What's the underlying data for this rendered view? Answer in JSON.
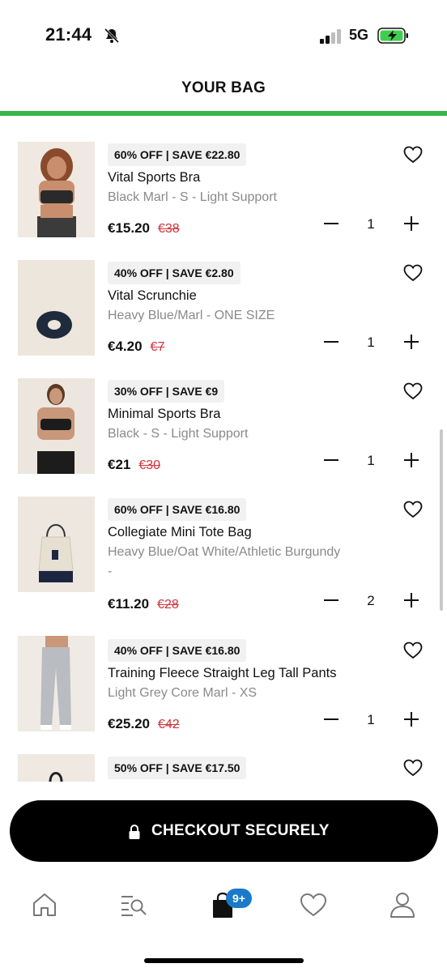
{
  "status_bar": {
    "time": "21:44",
    "network": "5G"
  },
  "header": {
    "title": "YOUR BAG",
    "accent_color": "#3ab54a"
  },
  "items": [
    {
      "badge": "60% OFF | SAVE €22.80",
      "name": "Vital Sports Bra",
      "variant": "Black Marl - S - Light Support",
      "variant_extra": "",
      "price": "€15.20",
      "was_price": "€38",
      "quantity": "1",
      "image": "sports-bra-model-photo"
    },
    {
      "badge": "40% OFF | SAVE €2.80",
      "name": "Vital Scrunchie",
      "variant": "Heavy Blue/Marl - ONE SIZE",
      "variant_extra": "",
      "price": "€4.20",
      "was_price": "€7",
      "quantity": "1",
      "image": "scrunchie-photo"
    },
    {
      "badge": "30% OFF | SAVE €9",
      "name": "Minimal Sports Bra",
      "variant": "Black - S - Light Support",
      "variant_extra": "",
      "price": "€21",
      "was_price": "€30",
      "quantity": "1",
      "image": "sports-bra-model-photo"
    },
    {
      "badge": "60% OFF | SAVE €16.80",
      "name": "Collegiate Mini Tote Bag",
      "variant": "Heavy Blue/Oat White/Athletic Burgundy",
      "variant_extra": "-",
      "price": "€11.20",
      "was_price": "€28",
      "quantity": "2",
      "image": "tote-bag-photo"
    },
    {
      "badge": "40% OFF | SAVE €16.80",
      "name": "Training Fleece Straight Leg Tall Pants",
      "variant": "Light Grey Core Marl - XS",
      "variant_extra": "",
      "price": "€25.20",
      "was_price": "€42",
      "quantity": "1",
      "image": "pants-model-photo"
    },
    {
      "badge": "50% OFF | SAVE €17.50",
      "name": "",
      "variant": "",
      "variant_extra": "",
      "price": "",
      "was_price": "",
      "quantity": "",
      "image": "partial-product-photo"
    }
  ],
  "checkout": {
    "label": "CHECKOUT SECURELY",
    "icon": "lock-icon"
  },
  "tabbar": {
    "tabs": [
      {
        "icon": "home-icon"
      },
      {
        "icon": "search-list-icon"
      },
      {
        "icon": "shopping-bag-icon"
      },
      {
        "icon": "heart-icon"
      },
      {
        "icon": "profile-icon"
      }
    ],
    "cart_badge": "9+",
    "badge_color": "#1a7ac9"
  }
}
